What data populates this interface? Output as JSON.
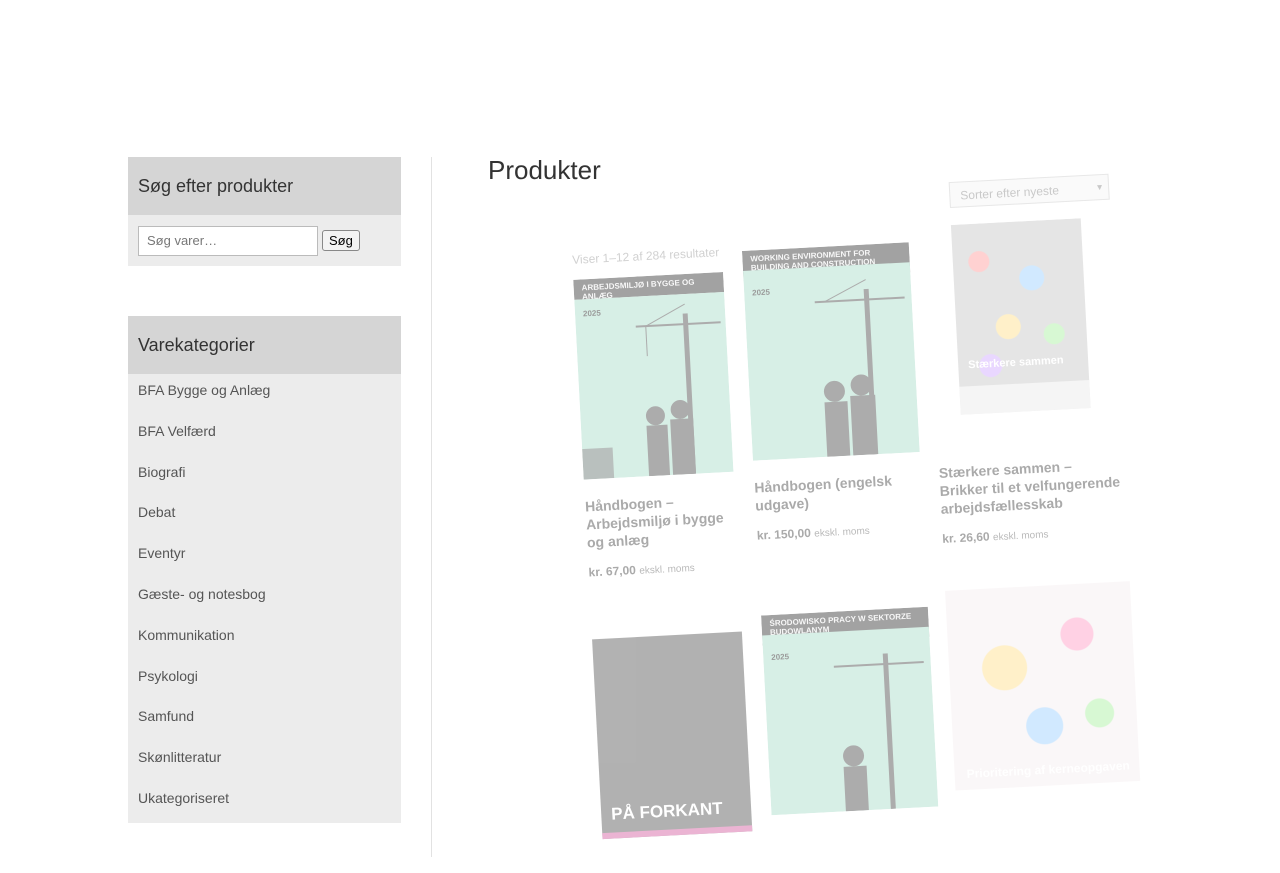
{
  "sidebar": {
    "search_widget": {
      "title": "Søg efter produkter",
      "placeholder": "Søg varer…",
      "button_label": "Søg"
    },
    "categories_widget": {
      "title": "Varekategorier",
      "items": [
        "BFA Bygge og Anlæg",
        "BFA Velfærd",
        "Biografi",
        "Debat",
        "Eventyr",
        "Gæste- og notesbog",
        "Kommunikation",
        "Psykologi",
        "Samfund",
        "Skønlitteratur",
        "Ukategoriseret"
      ]
    }
  },
  "main": {
    "title": "Produkter",
    "sort_select": "Sorter efter nyeste",
    "result_count": "Viser 1–12 af 284 resultater",
    "products": [
      {
        "cover_band": "ARBEJDSMILJØ I BYGGE OG ANLÆG",
        "cover_year": "2025",
        "title": "Håndbogen – Arbejdsmiljø i bygge og anlæg",
        "price": "kr. 67,00",
        "tax": "ekskl. moms"
      },
      {
        "cover_band": "WORKING ENVIRONMENT FOR BUILDING AND CONSTRUCTION",
        "cover_year": "2025",
        "title": "Håndbogen (engelsk udgave)",
        "price": "kr. 150,00",
        "tax": "ekskl. moms"
      },
      {
        "cover_label": "Stærkere sammen",
        "title": "Stærkere sammen – Brikker til et velfungerende arbejdsfællesskab",
        "price": "kr. 26,60",
        "tax": "ekskl. moms"
      },
      {
        "cover_label": "PÅ FORKANT"
      },
      {
        "cover_band": "ŚRODOWISKO PRACY W SEKTORZE BUDOWLANYM",
        "cover_year": "2025"
      },
      {
        "cover_label": "Prioritering af kerneopgaven"
      }
    ]
  },
  "colors": {
    "widget_bg": "#ececec",
    "widget_title_bg": "#d5d5d5",
    "cover_green": "#a8dcc8"
  }
}
